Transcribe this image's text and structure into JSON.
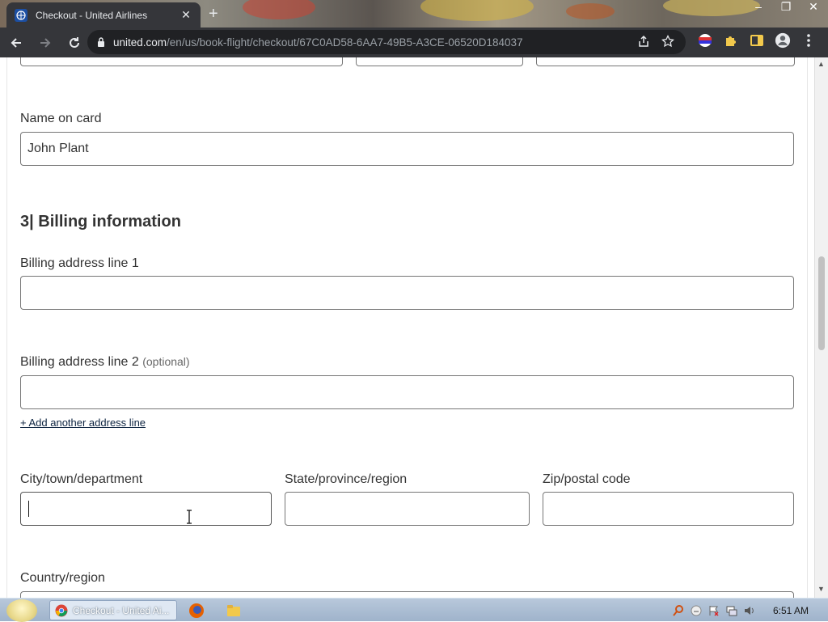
{
  "browser": {
    "tab_title": "Checkout - United Airlines",
    "tab_close": "✕",
    "new_tab": "+",
    "url_host": "united.com",
    "url_path": "/en/us/book-flight/checkout/67C0AD58-6AA7-49B5-A3CE-06520D184037"
  },
  "form": {
    "name_on_card_label": "Name on card",
    "name_on_card_value": "John Plant",
    "section_heading": "3| Billing information",
    "address1_label": "Billing address line 1",
    "address1_value": "",
    "address2_label": "Billing address line 2",
    "address2_optional": "(optional)",
    "address2_value": "",
    "add_line_link": "+ Add another address line",
    "city_label": "City/town/department",
    "city_value": "",
    "state_label": "State/province/region",
    "state_value": "",
    "zip_label": "Zip/postal code",
    "zip_value": "",
    "country_label": "Country/region"
  },
  "taskbar": {
    "active_task": "Checkout - United Ai...",
    "clock": "6:51 AM"
  },
  "colors": {
    "chrome_dark": "#35363a",
    "omnibox": "#202124",
    "input_border": "#767676",
    "link": "#0c2340"
  }
}
